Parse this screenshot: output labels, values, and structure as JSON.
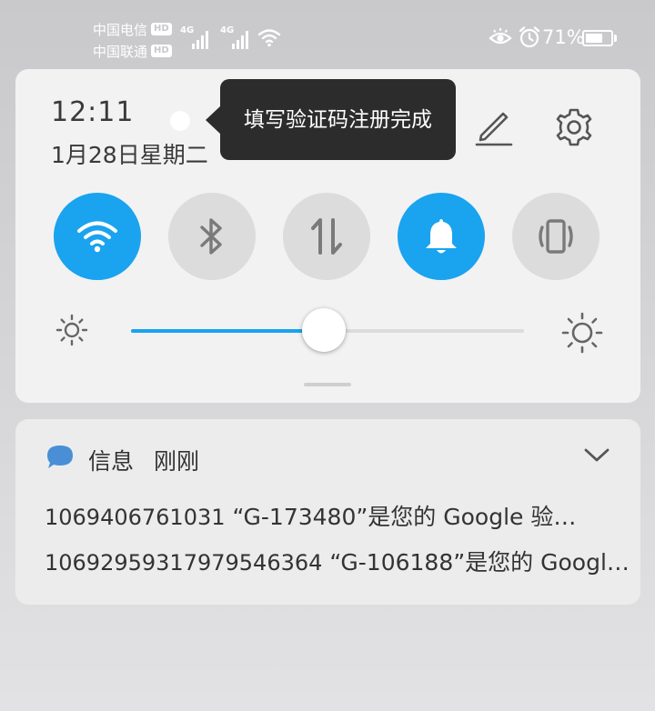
{
  "status_bar": {
    "carriers": [
      {
        "name": "中国电信",
        "badge": "HD"
      },
      {
        "name": "中国联通",
        "badge": "HD"
      }
    ],
    "signal_gen": [
      "4G",
      "4G"
    ],
    "battery_percent": "71%",
    "battery_level": 0.71,
    "icons": [
      "signal-icon",
      "wifi-icon",
      "eye-icon",
      "alarm-icon",
      "battery-icon"
    ]
  },
  "panel": {
    "time": "12:11",
    "date": "1月28日星期二",
    "tooltip": "填写验证码注册完成",
    "icons": [
      "edit-icon",
      "settings-icon"
    ],
    "toggles": [
      {
        "name": "wifi",
        "icon": "wifi-icon",
        "state": "on"
      },
      {
        "name": "bluetooth",
        "icon": "bluetooth-icon",
        "state": "off"
      },
      {
        "name": "mobile-data",
        "icon": "data-transfer-icon",
        "state": "off"
      },
      {
        "name": "sound",
        "icon": "bell-icon",
        "state": "on"
      },
      {
        "name": "vibrate",
        "icon": "vibrate-icon",
        "state": "off"
      }
    ],
    "brightness": 0.49
  },
  "notification": {
    "app": "信息",
    "time": "刚刚",
    "messages": [
      {
        "sender": "1069406761031",
        "text": "“G-173480”是您的 Google 验…"
      },
      {
        "sender": "10692959317979546364",
        "text": "“G-106188”是您的 Googl…"
      }
    ]
  },
  "colors": {
    "accent": "#1aa3ef",
    "toggle_off": "#dcdcdd",
    "panel_bg": "#f2f2f3",
    "tooltip_bg": "#2c2c2c"
  }
}
